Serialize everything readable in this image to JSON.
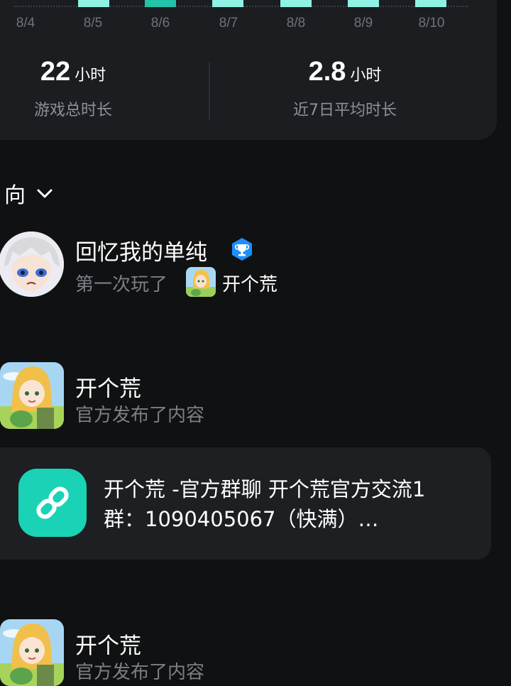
{
  "chart": {
    "dates": [
      "8/4",
      "8/5",
      "8/6",
      "8/7",
      "8/8",
      "8/9",
      "8/10"
    ],
    "active_date": "8/6",
    "bar_color": "#8ff0e4",
    "active_color": "#22c3a8"
  },
  "stats": {
    "total": {
      "value": "22",
      "unit": "小时",
      "caption": "游戏总时长"
    },
    "avg": {
      "value": "2.8",
      "unit": "小时",
      "caption": "近7日平均时长"
    }
  },
  "sort": {
    "label": "向"
  },
  "feed": {
    "user_post": {
      "name": "回忆我的单纯",
      "action": "第一次玩了",
      "game": "开个荒",
      "badge_icon": "trophy-badge-icon"
    },
    "official_post_1": {
      "title": "开个荒",
      "action": "官方发布了内容"
    },
    "link_card": {
      "text": "开个荒 -官方群聊 开个荒官方交流1群：1090405067（快满）…",
      "icon": "link-icon"
    },
    "official_post_2": {
      "title": "开个荒",
      "action": "官方发布了内容"
    }
  }
}
